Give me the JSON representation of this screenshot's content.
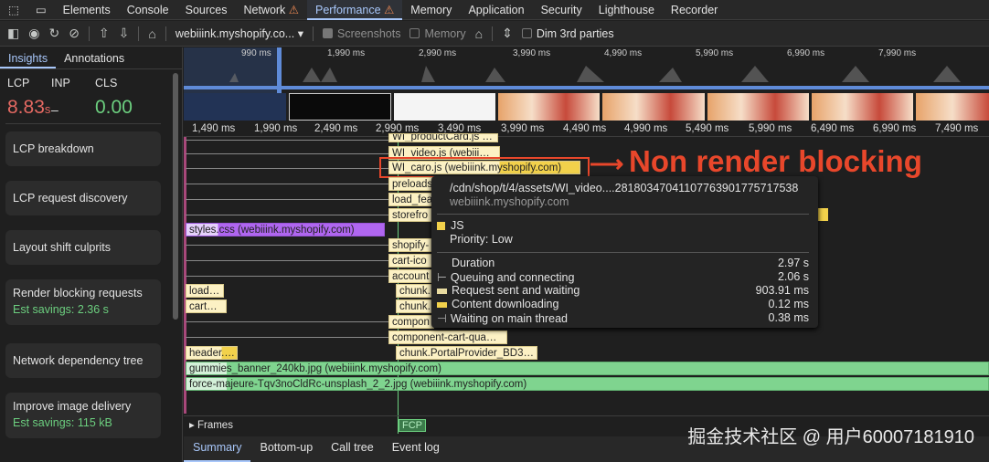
{
  "devtools_tabs": [
    {
      "label": "Elements"
    },
    {
      "label": "Console"
    },
    {
      "label": "Sources"
    },
    {
      "label": "Network",
      "warn": "⚠"
    },
    {
      "label": "Performance",
      "warn": "⚠"
    },
    {
      "label": "Memory"
    },
    {
      "label": "Application"
    },
    {
      "label": "Security"
    },
    {
      "label": "Lighthouse"
    },
    {
      "label": "Recorder"
    }
  ],
  "toolbar": {
    "url": "webiiink.myshopify.co...",
    "screenshots": "Screenshots",
    "memory": "Memory",
    "dim": "Dim 3rd parties"
  },
  "sidebar": {
    "tabs": [
      "Insights",
      "Annotations"
    ],
    "metrics": {
      "lcp_label": "LCP",
      "inp_label": "INP",
      "cls_label": "CLS",
      "lcp": "8.83",
      "lcp_unit": "s",
      "inp": "–",
      "cls": "0.00"
    },
    "cards": [
      {
        "title": "LCP breakdown"
      },
      {
        "title": "LCP request discovery"
      },
      {
        "title": "Layout shift culprits"
      },
      {
        "title": "Render blocking requests",
        "savings": "Est savings: 2.36 s"
      },
      {
        "title": "Network dependency tree"
      },
      {
        "title": "Improve image delivery",
        "savings": "Est savings: 115 kB"
      }
    ]
  },
  "overview_ticks": [
    "990 ms",
    "1,990 ms",
    "2,990 ms",
    "3,990 ms",
    "4,990 ms",
    "5,990 ms",
    "6,990 ms",
    "7,990 ms"
  ],
  "ruler_ticks": [
    "1,490 ms",
    "1,990 ms",
    "2,490 ms",
    "2,990 ms",
    "3,490 ms",
    "3,990 ms",
    "4,490 ms",
    "4,990 ms",
    "5,490 ms",
    "5,990 ms",
    "6,490 ms",
    "6,990 ms",
    "7,490 ms"
  ],
  "network_rows": [
    {
      "label": "WI_productCard.js …"
    },
    {
      "label": "WI_video.js (webiii…"
    },
    {
      "label": "WI_caro.js (webiiink.myshopify.com)"
    },
    {
      "label": "preloads"
    },
    {
      "label": "load_fea"
    },
    {
      "label": "storefro"
    },
    {
      "label": "styles.css (webiiink.myshopify.com)"
    },
    {
      "label": "shopify-"
    },
    {
      "label": "cart-ico"
    },
    {
      "label": "account"
    },
    {
      "label": "load…"
    },
    {
      "label": "chunk."
    },
    {
      "label": "cart…"
    },
    {
      "label": "chunk."
    },
    {
      "label": "compon"
    },
    {
      "label": "component-cart-qua…"
    },
    {
      "label": "header.…"
    },
    {
      "label": "chunk.PortalProvider_BD3…"
    },
    {
      "label": "gummies_banner_240kb.jpg (webiiink.myshopify.com)"
    },
    {
      "label": "force-majeure-Tqv3noCldRc-unsplash_2_2.jpg (webiiink.myshopify.com)"
    }
  ],
  "annotation": "Non render blocking",
  "tooltip": {
    "url": "/cdn/shop/t/4/assets/WI_video....281803470411077639017757175​38",
    "host": "webiiink.myshopify.com",
    "type": "JS",
    "priority": "Priority: Low",
    "rows": [
      {
        "label": "Duration",
        "value": "2.97 s"
      },
      {
        "label": "Queuing and connecting",
        "value": "2.06 s"
      },
      {
        "label": "Request sent and waiting",
        "value": "903.91 ms"
      },
      {
        "label": "Content downloading",
        "value": "0.12 ms"
      },
      {
        "label": "Waiting on main thread",
        "value": "0.38 ms"
      }
    ]
  },
  "frames": "Frames",
  "fcp": "FCP",
  "bottom_tabs": [
    "Summary",
    "Bottom-up",
    "Call tree",
    "Event log"
  ],
  "watermark": "掘金技术社区 @ 用户60007181910",
  "colors": {
    "accent": "#a8c7fa",
    "lcp": "#e46962",
    "cls": "#6ccf7f",
    "annotation": "#e8472b",
    "js": "#f2d14b",
    "css": "#b066f0",
    "img": "#7fd48f"
  }
}
